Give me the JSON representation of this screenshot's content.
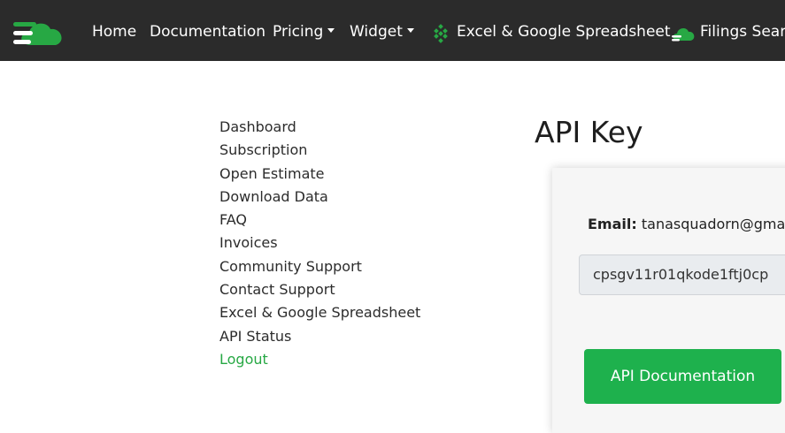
{
  "navbar": {
    "items": [
      {
        "label": "Home"
      },
      {
        "label": "Documentation"
      },
      {
        "label": "Pricing"
      },
      {
        "label": "Widget"
      },
      {
        "label": "Excel & Google Spreadsheet"
      },
      {
        "label": "Filings Searc"
      }
    ]
  },
  "sidebar": {
    "items": [
      {
        "label": "Dashboard"
      },
      {
        "label": "Subscription"
      },
      {
        "label": "Open Estimate"
      },
      {
        "label": "Download Data"
      },
      {
        "label": "FAQ"
      },
      {
        "label": "Invoices"
      },
      {
        "label": "Community Support"
      },
      {
        "label": "Contact Support"
      },
      {
        "label": "Excel & Google Spreadsheet"
      },
      {
        "label": "API Status"
      },
      {
        "label": "Logout"
      }
    ]
  },
  "main": {
    "title": "API Key",
    "email_label": "Email:",
    "email_value": "tanasquadorn@gmail.",
    "api_key_value": "cpsgv11r01qkode1ftj0cp",
    "api_doc_button": "API Documentation"
  },
  "colors": {
    "navbar_bg": "#2b2b2b",
    "brand_green": "#27a844",
    "button_green": "#1eb14d"
  }
}
